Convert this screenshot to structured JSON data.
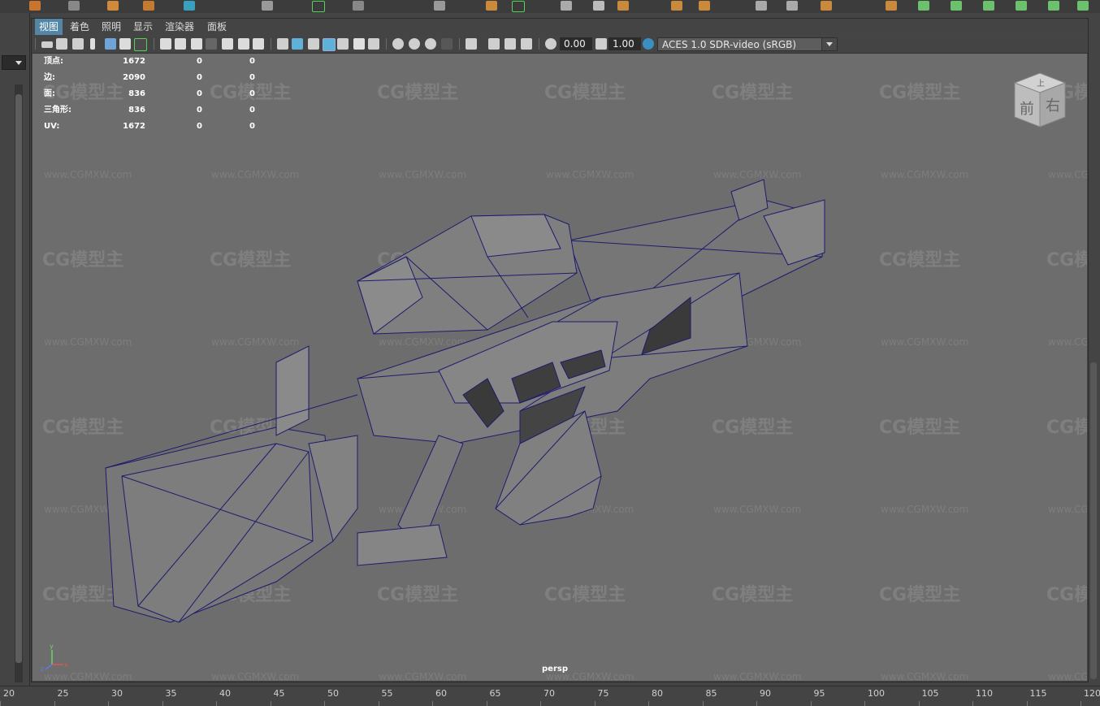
{
  "menu": [
    "视图",
    "着色",
    "照明",
    "显示",
    "渲染器",
    "面板"
  ],
  "toolbar": {
    "near_value": "0.00",
    "far_value": "1.00",
    "color_space": "ACES 1.0 SDR-video (sRGB)"
  },
  "hud": [
    {
      "label": "顶点:",
      "a": "1672",
      "b": "0",
      "c": "0"
    },
    {
      "label": "边:",
      "a": "2090",
      "b": "0",
      "c": "0"
    },
    {
      "label": "面:",
      "a": "836",
      "b": "0",
      "c": "0"
    },
    {
      "label": "三角形:",
      "a": "836",
      "b": "0",
      "c": "0"
    },
    {
      "label": "UV:",
      "a": "1672",
      "b": "0",
      "c": "0"
    }
  ],
  "camera": "persp",
  "viewcube": {
    "top": "上",
    "front": "前",
    "right": "右"
  },
  "axes": {
    "x": "x",
    "y": "y",
    "z": "z"
  },
  "watermark": {
    "logo": "CG模型主",
    "url": "www.CGMXW.com"
  },
  "timeline": [
    "20",
    "25",
    "30",
    "35",
    "40",
    "45",
    "50",
    "55",
    "60",
    "65",
    "70",
    "75",
    "80",
    "85",
    "90",
    "95",
    "100",
    "105",
    "110",
    "115",
    "120"
  ]
}
